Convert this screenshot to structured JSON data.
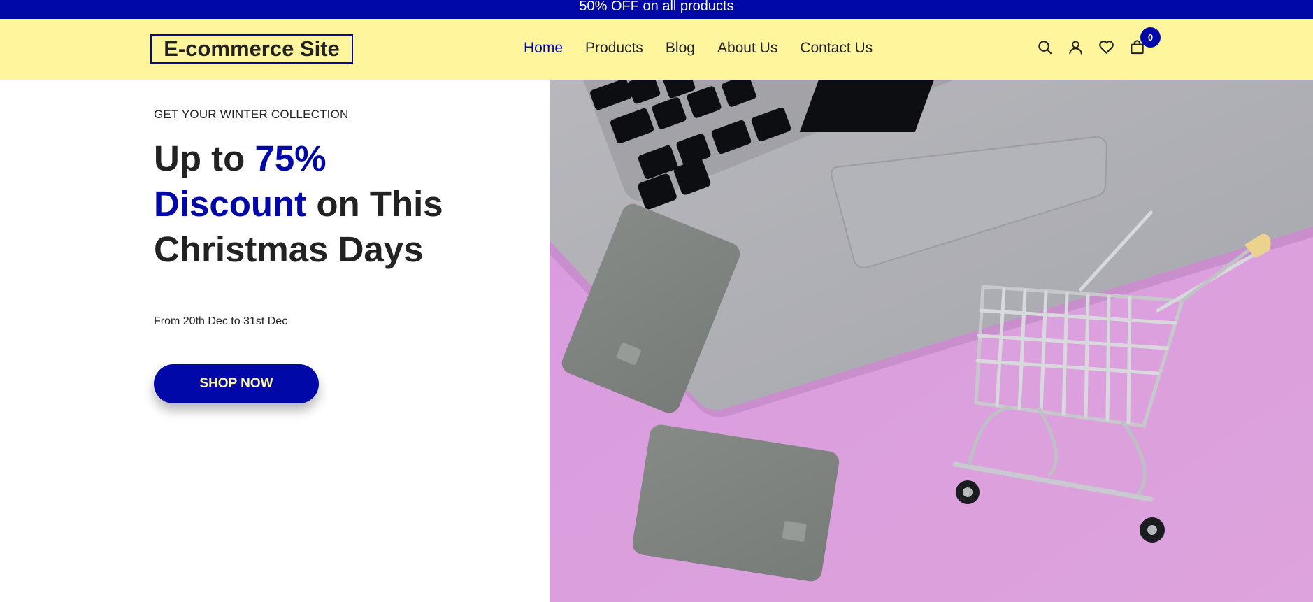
{
  "promo": {
    "text": "50% OFF on all products"
  },
  "header": {
    "logo": "E-commerce Site",
    "nav": [
      {
        "label": "Home",
        "active": true
      },
      {
        "label": "Products",
        "active": false
      },
      {
        "label": "Blog",
        "active": false
      },
      {
        "label": "About Us",
        "active": false
      },
      {
        "label": "Contact Us",
        "active": false
      }
    ],
    "icons": [
      "search-icon",
      "user-icon",
      "heart-icon",
      "shopping-bag-icon"
    ],
    "cart_count": "0"
  },
  "hero": {
    "eyebrow": "GET YOUR WINTER COLLECTION",
    "headline": {
      "part1": "Up to ",
      "accent1": "75%",
      "accent2": "Discount",
      "part2": " on This Christmas Days"
    },
    "dates": "From 20th Dec to 31st Dec",
    "cta": "SHOP NOW"
  },
  "colors": {
    "brand_blue": "#0008a8",
    "header_yellow": "#fff59d",
    "text_dark": "#222222",
    "image_background_pink": "#d998dc"
  }
}
